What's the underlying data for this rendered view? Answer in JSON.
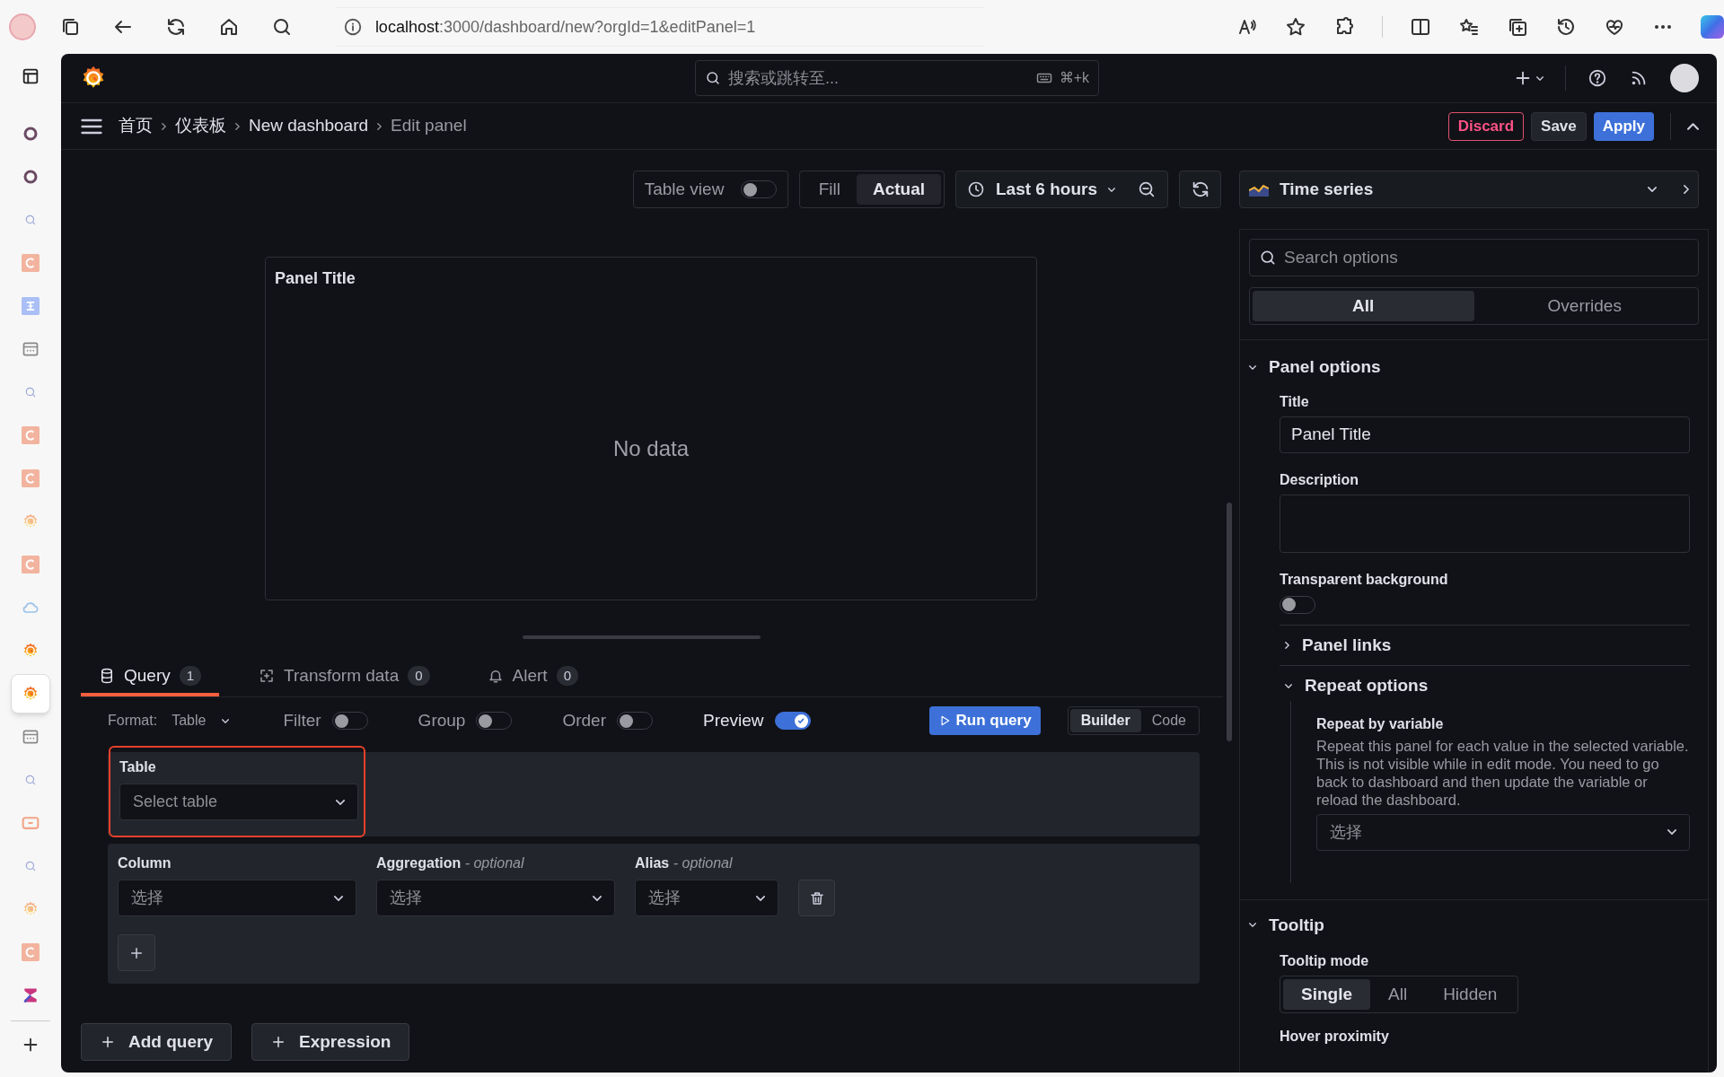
{
  "browser": {
    "url_host": "localhost",
    "url_rest": ":3000/dashboard/new?orgId=1&editPanel=1"
  },
  "tab_strip": [
    {
      "kind": "circle",
      "selected": false
    },
    {
      "kind": "circle",
      "selected": false
    },
    {
      "kind": "search",
      "selected": false
    },
    {
      "kind": "c",
      "selected": false
    },
    {
      "kind": "h",
      "selected": false
    },
    {
      "kind": "page",
      "selected": false
    },
    {
      "kind": "search",
      "selected": false
    },
    {
      "kind": "c",
      "selected": false
    },
    {
      "kind": "c",
      "selected": false
    },
    {
      "kind": "grafana-faded",
      "selected": false
    },
    {
      "kind": "c",
      "selected": false
    },
    {
      "kind": "cloud",
      "selected": false
    },
    {
      "kind": "grafana",
      "selected": false
    },
    {
      "kind": "grafana",
      "selected": true
    },
    {
      "kind": "page",
      "selected": false
    },
    {
      "kind": "search",
      "selected": false
    },
    {
      "kind": "bracket",
      "selected": false
    },
    {
      "kind": "search",
      "selected": false
    },
    {
      "kind": "grafana-faded",
      "selected": false
    },
    {
      "kind": "c",
      "selected": false
    },
    {
      "kind": "sigma",
      "selected": false
    }
  ],
  "header": {
    "search_placeholder": "搜索或跳转至...",
    "shortcut": "⌘+k"
  },
  "breadcrumbs": [
    {
      "label": "首页",
      "current": false
    },
    {
      "label": "仪表板",
      "current": false
    },
    {
      "label": "New dashboard",
      "current": false
    },
    {
      "label": "Edit panel",
      "current": true
    }
  ],
  "actions": [
    {
      "label": "Discard",
      "kind": "danger"
    },
    {
      "label": "Save",
      "kind": "secondary"
    },
    {
      "label": "Apply",
      "kind": "primary"
    }
  ],
  "toolbar": {
    "table_view": {
      "label": "Table view",
      "on": false
    },
    "size_modes": [
      {
        "label": "Fill",
        "selected": false
      },
      {
        "label": "Actual",
        "selected": true
      }
    ],
    "time_range": "Last 6 hours"
  },
  "panel": {
    "title": "Panel Title",
    "message": "No data"
  },
  "query_tabs": [
    {
      "kind": "query",
      "label": "Query",
      "count": "1",
      "selected": true
    },
    {
      "kind": "transform",
      "label": "Transform data",
      "count": "0",
      "selected": false
    },
    {
      "kind": "alert",
      "label": "Alert",
      "count": "0",
      "selected": false
    }
  ],
  "query_options": {
    "format_label": "Format:",
    "format_value": "Table",
    "toggles": [
      {
        "label": "Filter",
        "on": false
      },
      {
        "label": "Group",
        "on": false
      },
      {
        "label": "Order",
        "on": false
      },
      {
        "label": "Preview",
        "on": true
      }
    ],
    "run_label": "Run query",
    "modes": [
      {
        "label": "Builder",
        "selected": true
      },
      {
        "label": "Code",
        "selected": false
      }
    ]
  },
  "table_field": {
    "label": "Table",
    "placeholder": "Select table",
    "highlighted": true
  },
  "column_fields": [
    {
      "label": "Column",
      "placeholder": "选择"
    },
    {
      "label": "Aggregation",
      "hint": "- optional",
      "placeholder": "选择"
    },
    {
      "label": "Alias",
      "hint": "- optional",
      "placeholder": "选择"
    }
  ],
  "add_buttons": [
    "Add query",
    "Expression"
  ],
  "options": {
    "visualization": "Time series",
    "search_placeholder": "Search options",
    "tabs": [
      {
        "label": "All",
        "selected": true
      },
      {
        "label": "Overrides",
        "selected": false
      }
    ],
    "panel_options": {
      "heading": "Panel options",
      "expanded": true,
      "title_label": "Title",
      "title_value": "Panel Title",
      "description_label": "Description",
      "transparent_label": "Transparent background",
      "transparent_on": false,
      "links": {
        "heading": "Panel links",
        "expanded": false
      },
      "repeat": {
        "heading": "Repeat options",
        "expanded": true,
        "label": "Repeat by variable",
        "description": "Repeat this panel for each value in the selected variable. This is not visible while in edit mode. You need to go back to dashboard and then update the variable or reload the dashboard.",
        "placeholder": "选择"
      }
    },
    "tooltip": {
      "heading": "Tooltip",
      "expanded": true,
      "mode_label": "Tooltip mode",
      "modes": [
        {
          "label": "Single",
          "selected": true
        },
        {
          "label": "All",
          "selected": false
        },
        {
          "label": "Hidden",
          "selected": false
        }
      ],
      "proximity_label": "Hover proximity"
    }
  }
}
